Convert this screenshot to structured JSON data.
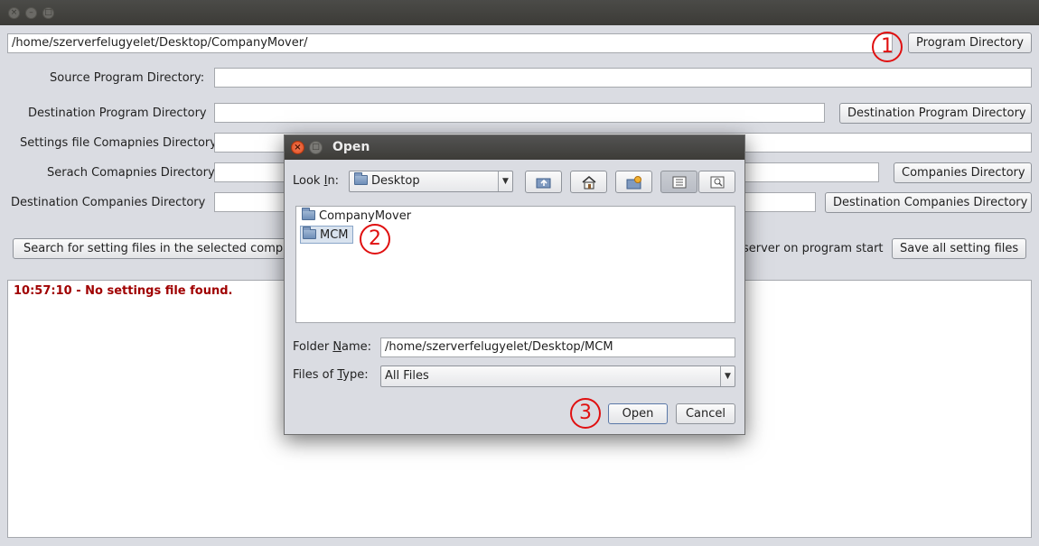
{
  "window": {
    "close_glyph": "×",
    "min_glyph": "–",
    "max_glyph": "□"
  },
  "main": {
    "program_path": "/home/szerverfelugyelet/Desktop/CompanyMover/",
    "program_directory_button": "Program Directory",
    "source_label": "Source Program Directory:",
    "source_value": "",
    "destination_label": "Destination Program Directory",
    "destination_value": "",
    "destination_button": "Destination Program Directory",
    "settings_label": "Settings file Comapnies Directory",
    "settings_value": "",
    "search_label": "Serach Comapnies Directory",
    "search_value": "",
    "companies_button": "Companies Directory",
    "dest_companies_label": "Destination Companies Directory",
    "dest_companies_value": "",
    "dest_companies_button": "Destination Companies Directory",
    "search_settings_button": "Search for setting files in the selected companies",
    "server_start_text": "server on program start",
    "save_all_button": "Save all setting files",
    "log_line": "10:57:10 - No settings file found."
  },
  "annotations": {
    "step1": "1",
    "step2": "2",
    "step3": "3",
    "color": "#e01010"
  },
  "dialog": {
    "title": "Open",
    "look_in_label_pre": "Look ",
    "look_in_label_mn": "I",
    "look_in_label_post": "n:",
    "look_in_value": "Desktop",
    "files": [
      {
        "name": "CompanyMover",
        "selected": false
      },
      {
        "name": "MCM",
        "selected": true
      }
    ],
    "folder_name_label_pre": "Folder ",
    "folder_name_label_mn": "N",
    "folder_name_label_post": "ame:",
    "folder_name_value": "/home/szerverfelugyelet/Desktop/MCM",
    "files_of_type_label_pre": "Files of ",
    "files_of_type_label_mn": "T",
    "files_of_type_label_post": "ype:",
    "files_of_type_value": "All Files",
    "open_button": "Open",
    "cancel_button": "Cancel",
    "toolbar_icons": [
      "up-folder-icon",
      "home-icon",
      "new-folder-icon",
      "list-view-icon",
      "details-view-icon"
    ]
  }
}
